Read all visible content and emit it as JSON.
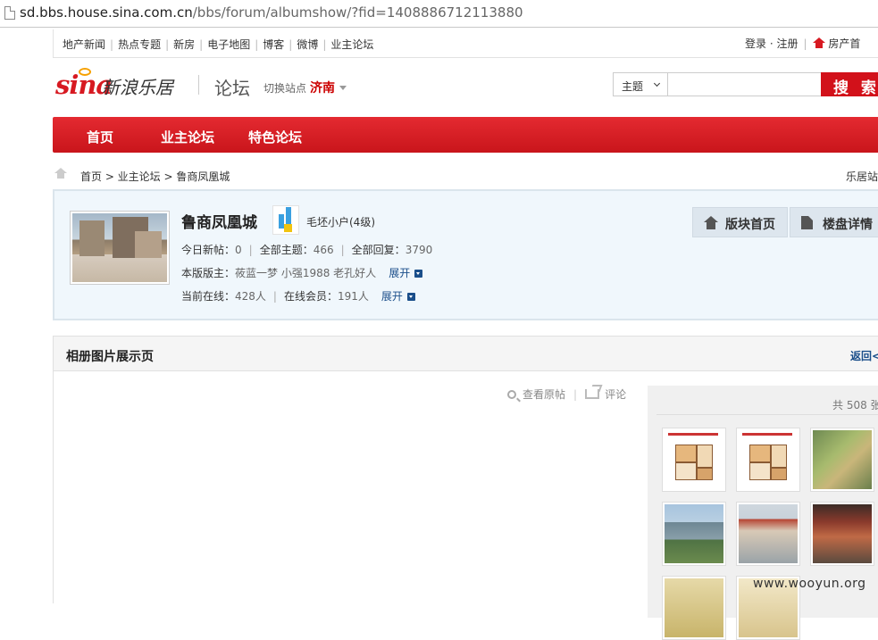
{
  "browser": {
    "url_host": "sd.bbs.house.sina.com.cn",
    "url_path": "/bbs/forum/albumshow/?fid=1408886712113880"
  },
  "topbar": {
    "links": [
      "地产新闻",
      "热点专题",
      "新房",
      "电子地图",
      "博客",
      "微博",
      "业主论坛"
    ],
    "login": "登录",
    "register": "注册",
    "home_label": "房产首"
  },
  "header": {
    "logo_text": "sina",
    "logo_sub": "新浪乐居",
    "section_title": "论坛",
    "switch_label": "切换站点",
    "city": "济南",
    "search": {
      "select_value": "主题",
      "placeholder": "",
      "button": "搜 索"
    }
  },
  "nav": {
    "items": [
      "首页",
      "业主论坛",
      "特色论坛"
    ]
  },
  "breadcrumb": {
    "path": "首页 > 业主论坛 > 鲁商凤凰城",
    "right": "乐居站"
  },
  "forum": {
    "name": "鲁商凤凰城",
    "level": "毛坯小户(4级)",
    "today_label": "今日新帖：",
    "today_value": "0",
    "topics_label": "全部主题：",
    "topics_value": "466",
    "replies_label": "全部回复：",
    "replies_value": "3790",
    "moderators_label": "本版版主：",
    "moderators": "莜蓝一梦 小强1988 老孔好人",
    "expand1": "展开",
    "online_label": "当前在线：",
    "online_value": "428人",
    "members_label": "在线会员：",
    "members_value": "191人",
    "expand2": "展开",
    "btn_home": "版块首页",
    "btn_detail": "楼盘详情"
  },
  "album": {
    "title": "相册图片展示页",
    "back": "返回<",
    "view_original": "查看原帖",
    "comment": "评论",
    "count": "共 508 张"
  },
  "watermark": "www.wooyun.org"
}
